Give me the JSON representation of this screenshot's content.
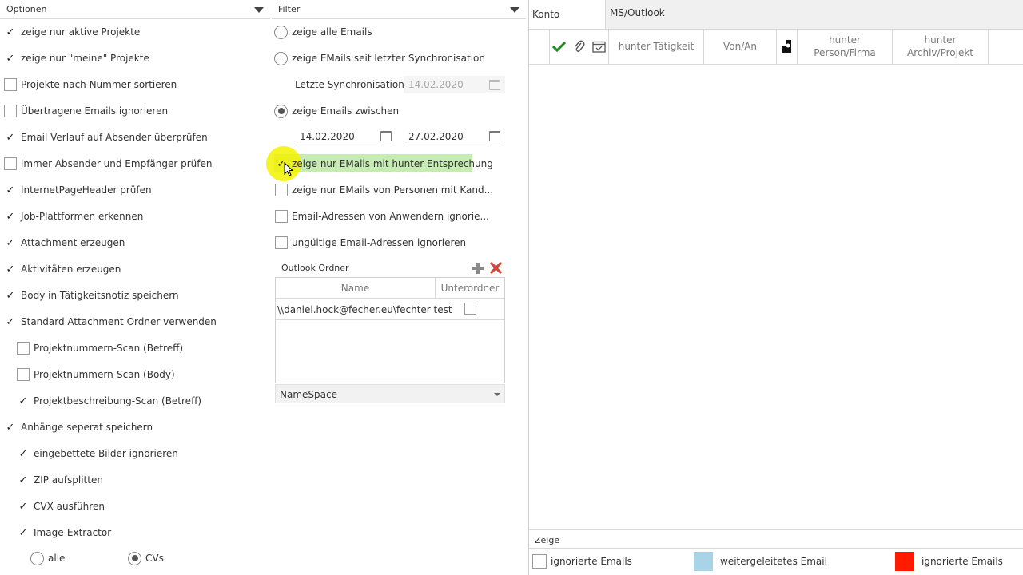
{
  "left_panel": {
    "title": "Optionen",
    "options": [
      {
        "label": "zeige nur aktive Projekte",
        "checked": true
      },
      {
        "label": "zeige nur \"meine\" Projekte",
        "checked": true
      },
      {
        "label": "Projekte nach Nummer sortieren",
        "checked": false
      },
      {
        "label": "Übertragene Emails ignorieren",
        "checked": false
      },
      {
        "label": "Email Verlauf auf Absender überprüfen",
        "checked": true
      },
      {
        "label": "immer Absender und Empfänger prüfen",
        "checked": false
      },
      {
        "label": "InternetPageHeader prüfen",
        "checked": true
      },
      {
        "label": "Job-Plattformen erkennen",
        "checked": true
      },
      {
        "label": "Attachment erzeugen",
        "checked": true
      },
      {
        "label": "Aktivitäten erzeugen",
        "checked": true
      },
      {
        "label": "Body in Tätigkeitsnotiz speichern",
        "checked": true
      },
      {
        "label": "Standard Attachment Ordner verwenden",
        "checked": true
      },
      {
        "label": "Projektnummern-Scan (Betreff)",
        "checked": false
      },
      {
        "label": "Projektnummern-Scan (Body)",
        "checked": false
      },
      {
        "label": "Projektbeschreibung-Scan (Betreff)",
        "checked": true
      },
      {
        "label": "Anhänge seperat speichern",
        "checked": true
      },
      {
        "label": "eingebettete Bilder ignorieren",
        "checked": true
      },
      {
        "label": "ZIP aufsplitten",
        "checked": true
      },
      {
        "label": "CVX ausführen",
        "checked": true
      },
      {
        "label": "Image-Extractor",
        "checked": true
      }
    ],
    "extract_mode": {
      "all_label": "alle",
      "cvs_label": "CVs",
      "selected": "CVs"
    }
  },
  "filter_panel": {
    "title": "Filter",
    "radio_all": "zeige alle Emails",
    "radio_since_sync": "zeige EMails seit letzter Synchronisation",
    "last_sync_label": "Letzte Synchronisation",
    "last_sync_date": "14.02.2020",
    "radio_between": "zeige Emails zwischen",
    "radio_selected": "between",
    "date_from": "14.02.2020",
    "date_to": "27.02.2020",
    "checks": [
      {
        "label": "zeige nur EMails mit hunter Entsprechung",
        "checked": true
      },
      {
        "label": "zeige nur EMails von Personen mit Kand...",
        "checked": false
      },
      {
        "label": "Email-Adressen von Anwendern ignorie...",
        "checked": false
      },
      {
        "label": "ungültige Email-Adressen ignorieren",
        "checked": false
      }
    ],
    "outlook_folder": {
      "title": "Outlook Ordner",
      "col_name": "Name",
      "col_sub": "Unterordner",
      "rows": [
        {
          "name": "\\\\daniel.hock@fecher.eu\\fechter test",
          "subfolders": false
        }
      ],
      "namespace_value": "NameSpace"
    }
  },
  "right_panel": {
    "tab_account": "Konto",
    "tab_outlook": "MS/Outlook",
    "columns": {
      "activity": "hunter Tätigkeit",
      "from_to": "Von/An",
      "person_line1": "hunter",
      "person_line2": "Person/Firma",
      "archive_line1": "hunter",
      "archive_line2": "Archiv/Projekt"
    },
    "footer_label": "Zeige",
    "legend": [
      {
        "label": "ignorierte Emails",
        "color": "#ffffff"
      },
      {
        "label": "weitergeleitetes Email",
        "color": "#a8d4e8"
      },
      {
        "label": "ignorierte Emails",
        "color": "#ff1a00"
      }
    ]
  },
  "colors": {
    "highlight_green": "#c6ecb4",
    "cursor_yellow": "#f2f200",
    "check_green": "#1a8a1a",
    "delete_red": "#d9413a",
    "add_grey": "#8a8a8a"
  }
}
